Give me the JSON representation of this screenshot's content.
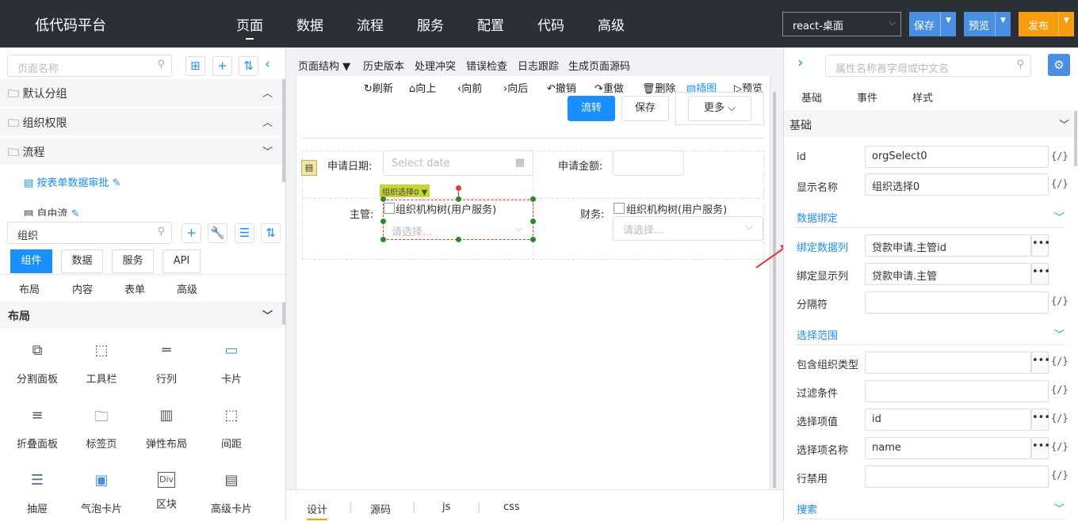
{
  "app": {
    "title": "低代码平台"
  },
  "nav": [
    "页面",
    "数据",
    "流程",
    "服务",
    "配置",
    "代码",
    "高级"
  ],
  "topright": {
    "env": "react-桌面",
    "save": "保存",
    "preview": "预览",
    "publish": "发布"
  },
  "left": {
    "search_placeholder": "页面名称",
    "groups": [
      {
        "label": "默认分组",
        "open": true
      },
      {
        "label": "组织权限",
        "open": true
      },
      {
        "label": "流程",
        "open": false
      }
    ],
    "pages": [
      "按表单数据审批",
      "自由流"
    ],
    "comp_search": "组织",
    "tabs": [
      "组件",
      "数据",
      "服务",
      "API"
    ],
    "subtabs": [
      "布局",
      "内容",
      "表单",
      "高级"
    ],
    "section": "布局",
    "components": [
      [
        "分割面板",
        "工具栏",
        "行列",
        "卡片"
      ],
      [
        "折叠面板",
        "标签页",
        "弹性布局",
        "间距"
      ],
      [
        "抽屉",
        "气泡卡片",
        "区块",
        "高级卡片"
      ]
    ]
  },
  "canvas": {
    "toolbar": [
      "页面结构 ▼",
      "历史版本",
      "处理冲突",
      "错误检查",
      "日志跟踪",
      "生成页面源码"
    ],
    "tools": [
      "刷新",
      "向上",
      "向前",
      "向后",
      "撤销",
      "重做",
      "删除",
      "插图",
      "预览"
    ],
    "buttons": {
      "flow": "流转",
      "save": "保存",
      "more": "更多"
    },
    "form": {
      "date_label": "申请日期:",
      "date_placeholder": "Select date",
      "amount_label": "申请金额:",
      "mgr_label": "主管:",
      "fin_label": "财务:",
      "org_tree": "组织机构树(用户服务)",
      "select_placeholder": "请选择...",
      "tag": "组织选择0"
    },
    "bottom_tabs": [
      "设计",
      "源码",
      "js",
      "css"
    ]
  },
  "right": {
    "search_placeholder": "属性名称首字母或中文名",
    "tabs": [
      "基础",
      "事件",
      "样式"
    ],
    "section_basic": "基础",
    "fields": [
      {
        "label": "id",
        "value": "orgSelect0"
      },
      {
        "label": "显示名称",
        "value": "组织选择0"
      }
    ],
    "binding_title": "数据绑定",
    "bind_col": {
      "label": "绑定数据列",
      "value": "贷款申请.主管id"
    },
    "bind_disp": {
      "label": "绑定显示列",
      "value": "贷款申请.主管"
    },
    "sep": {
      "label": "分隔符",
      "value": ""
    },
    "range_title": "选择范围",
    "org_type": {
      "label": "包含组织类型",
      "value": ""
    },
    "filter": {
      "label": "过滤条件",
      "value": ""
    },
    "opt_val": {
      "label": "选择项值",
      "value": "id"
    },
    "opt_name": {
      "label": "选择项名称",
      "value": "name"
    },
    "row_disabled": {
      "label": "行禁用",
      "value": ""
    },
    "search_title": "搜索",
    "expr": "{/}"
  },
  "colors": {
    "primary": "#1890ff",
    "topbar": "#2b3037",
    "publish": "#fa9d0b"
  }
}
